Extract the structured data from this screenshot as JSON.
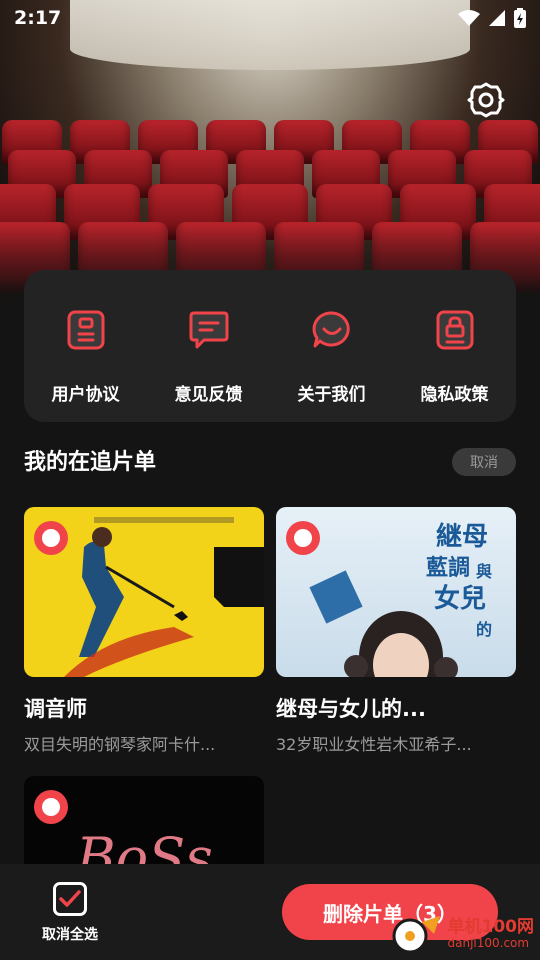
{
  "status_bar": {
    "time": "2:17"
  },
  "menu": {
    "items": [
      {
        "label": "用户协议",
        "icon": "agreement-doc-icon"
      },
      {
        "label": "意见反馈",
        "icon": "feedback-chat-icon"
      },
      {
        "label": "关于我们",
        "icon": "smile-chat-icon"
      },
      {
        "label": "隐私政策",
        "icon": "privacy-lock-icon"
      }
    ]
  },
  "watchlist": {
    "title": "我的在追片单",
    "cancel_label": "取消",
    "cards": [
      {
        "title": "调音师",
        "desc": "双目失明的钢琴家阿卡什...",
        "selected": true
      },
      {
        "title": "继母与女儿的...",
        "desc": "32岁职业女性岩木亚希子...",
        "selected": true
      },
      {
        "title": "",
        "desc": "",
        "selected": true
      }
    ]
  },
  "poster_text": {
    "poster2_title_a": "継母",
    "poster2_title_b": "與",
    "poster2_title_c": "女兒",
    "poster2_title_d": "的",
    "poster2_title_e": "藍調",
    "poster3_title": "BoSs"
  },
  "bottom_bar": {
    "select_all_label": "取消全选",
    "delete_label": "删除片单（3）"
  },
  "watermark": {
    "cn": "单机100网",
    "en": "danji100.com"
  },
  "colors": {
    "accent": "#f0444a",
    "background": "#141414",
    "card": "#232323"
  }
}
